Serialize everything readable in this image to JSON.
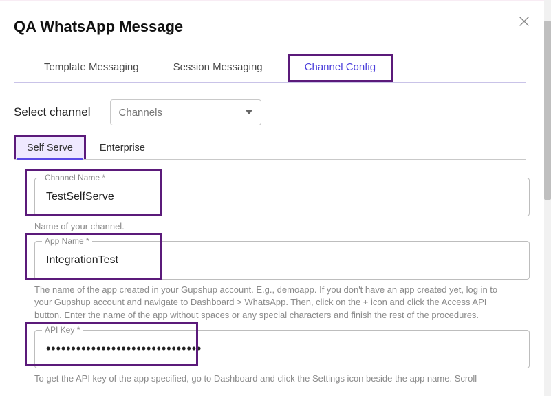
{
  "title": "QA WhatsApp Message",
  "tabs": {
    "template": "Template Messaging",
    "session": "Session Messaging",
    "channel": "Channel Config"
  },
  "select_channel_label": "Select channel",
  "channels_dropdown": "Channels",
  "subtabs": {
    "self_serve": "Self Serve",
    "enterprise": "Enterprise"
  },
  "fields": {
    "channel_name": {
      "label": "Channel Name *",
      "value": "TestSelfServe",
      "hint": "Name of your channel."
    },
    "app_name": {
      "label": "App Name *",
      "value": "IntegrationTest",
      "hint": "The name of the app created in your Gupshup account. E.g., demoapp. If you don't have an app created yet, log in to your Gupshup account and navigate to Dashboard > WhatsApp. Then, click on the + icon and click the Access API button. Enter the name of the app without spaces or any special characters and finish the rest of the procedures."
    },
    "api_key": {
      "label": "API Key *",
      "value": "•••••••••••••••••••••••••••••••",
      "hint": "To get the API key of the app specified, go to Dashboard and click the Settings icon beside the app name. Scroll"
    }
  }
}
